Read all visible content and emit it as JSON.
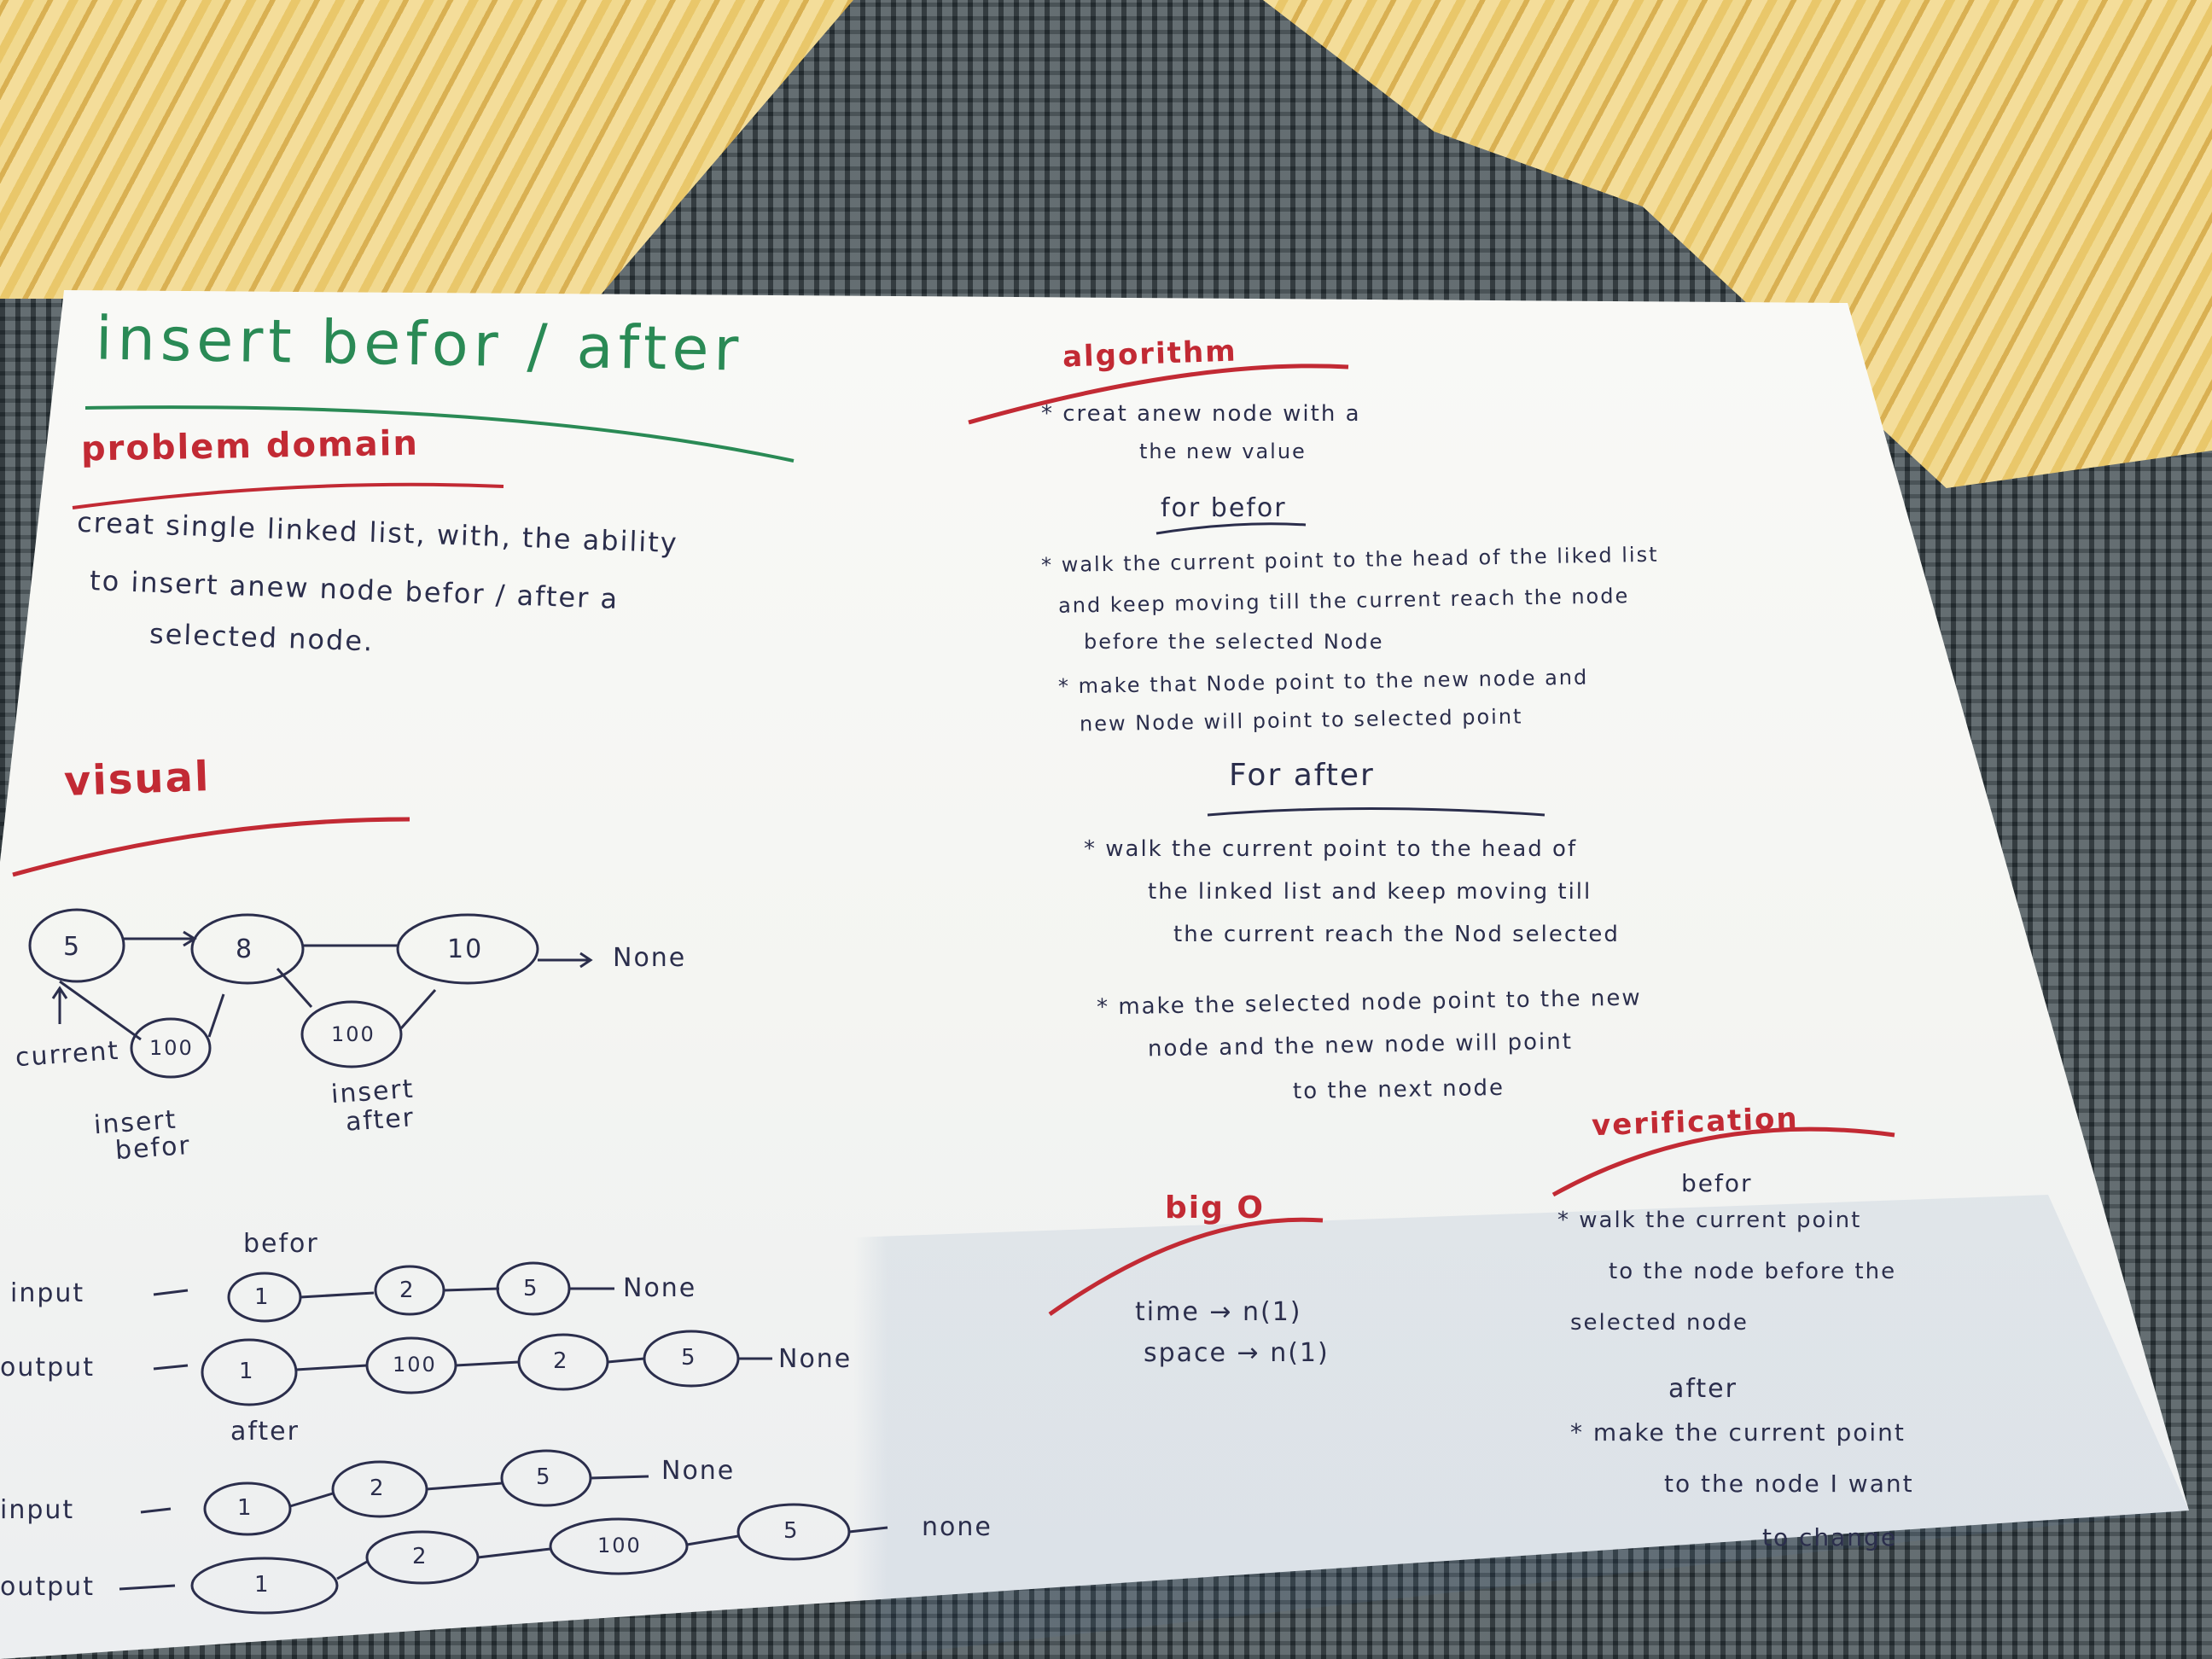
{
  "left": {
    "title": "insert befor / after",
    "problem_heading": "problem domain",
    "problem_lines": [
      "creat single linked list, with, the ability",
      "to insert anew node befor / after a",
      "selected node."
    ],
    "visual_heading": "visual",
    "diagram": {
      "nodes": [
        "5",
        "8",
        "10",
        "100",
        "100"
      ],
      "none_label": "None",
      "current_label": "current",
      "insert_befor_label": [
        "insert",
        "befor"
      ],
      "insert_after_label": [
        "insert",
        "after"
      ]
    },
    "examples": {
      "befor_label": "befor",
      "after_label": "after",
      "input_label": "input",
      "output_label": "output",
      "befor_input": [
        "1",
        "2",
        "5"
      ],
      "befor_output": [
        "1",
        "100",
        "2",
        "5"
      ],
      "after_input": [
        "1",
        "2",
        "5"
      ],
      "after_output": [
        "1",
        "2",
        "100",
        "5"
      ],
      "none_a": "None",
      "none_b": "None",
      "none_c": "None",
      "none_d": "none"
    }
  },
  "right": {
    "algorithm_heading": "algorithm",
    "algorithm_lines": [
      "* creat anew node with a",
      "the new value"
    ],
    "befor_heading": "for befor",
    "befor_lines": [
      "* walk the current point to the head of the liked list",
      "and keep moving till the current reach the node",
      "before the selected Node",
      "* make that Node point to the new node and",
      "new Node will point to selected point"
    ],
    "after_heading": "For after",
    "after_lines": [
      "* walk the current point to the head of",
      "the linked list and keep moving till",
      "the current reach the Nod selected",
      "* make the selected node point to the new",
      "node and the new node will point",
      "to the next node"
    ],
    "bigo_heading": "big O",
    "bigo_lines": [
      "time → n(1)",
      "space → n(1)"
    ],
    "verification_heading": "verification",
    "verif_befor_label": "befor",
    "verif_befor_lines": [
      "* walk the current point",
      "to the node before the",
      "selected node"
    ],
    "verif_after_label": "after",
    "verif_after_lines": [
      "* make the current point",
      "to the node I want",
      "to change"
    ]
  },
  "colors": {
    "ink_blue": "#2b2e4c",
    "ink_green": "#2a8a55",
    "ink_red": "#c22a34"
  }
}
